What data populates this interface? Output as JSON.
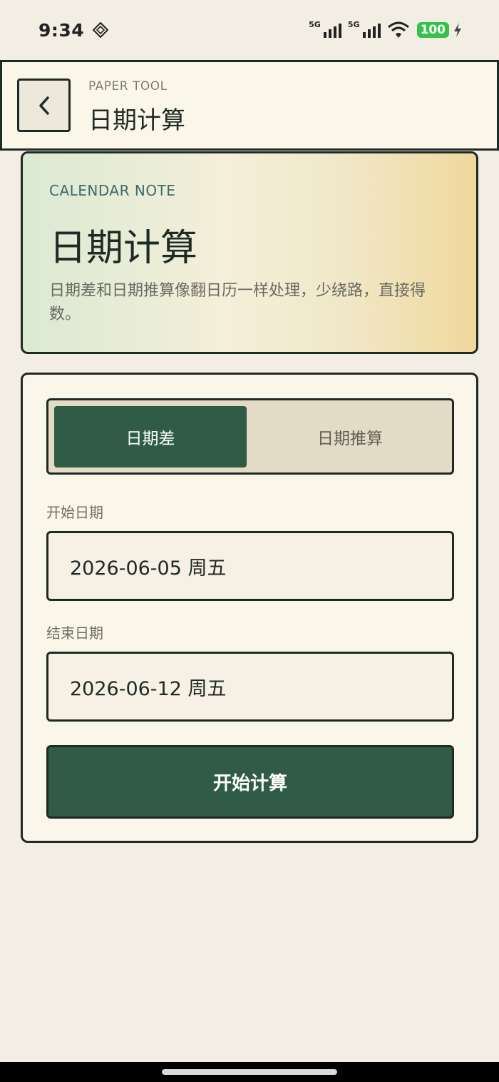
{
  "status_bar": {
    "time": "9:34",
    "network_1": "5G",
    "network_2": "5G",
    "battery": "100"
  },
  "header": {
    "kicker": "PAPER TOOL",
    "title": "日期计算"
  },
  "hero": {
    "kicker": "CALENDAR NOTE",
    "title": "日期计算",
    "description": "日期差和日期推算像翻日历一样处理，少绕路，直接得数。"
  },
  "tabs": [
    {
      "label": "日期差",
      "active": true
    },
    {
      "label": "日期推算",
      "active": false
    }
  ],
  "form": {
    "start_label": "开始日期",
    "start_value": "2026-06-05  周五",
    "end_label": "结束日期",
    "end_value": "2026-06-12  周五",
    "submit_label": "开始计算"
  },
  "colors": {
    "accent": "#2f5b47",
    "background": "#f2eee4",
    "card": "#fbf6ea",
    "border": "#1f2a24"
  }
}
